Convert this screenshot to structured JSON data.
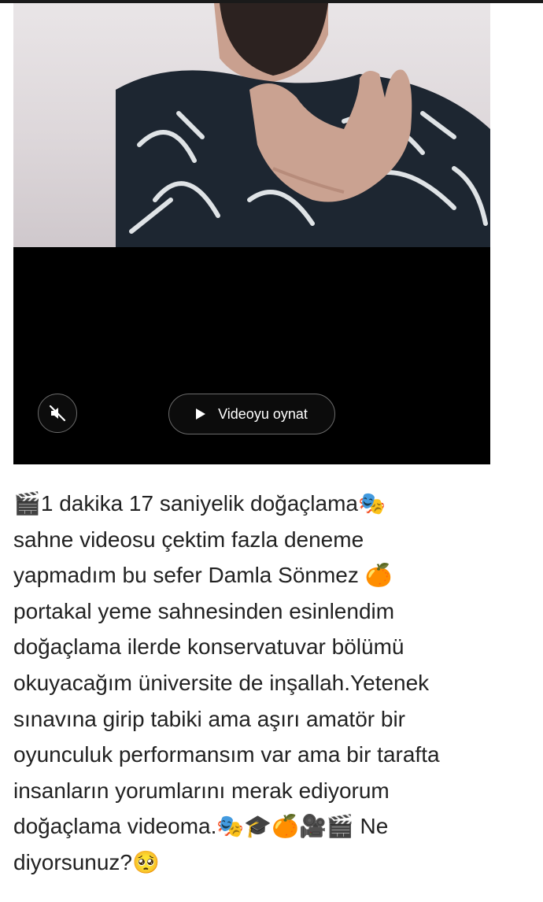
{
  "video": {
    "play_label": "Videoyu oynat",
    "mute_icon": "muted-speaker-icon",
    "play_icon": "play-icon",
    "accent": "#000000"
  },
  "post": {
    "caption": "🎬1 dakika 17 saniyelik doğaçlama🎭\nsahne videosu çektim fazla deneme\nyapmadım bu sefer Damla Sönmez 🍊\nportakal yeme sahnesinden esinlendim\ndoğaçlama ilerde konservatuvar bölümü\nokuyacağım üniversite de inşallah.Yetenek\nsınavına girip tabiki ama aşırı amatör bir\noyunculuk performansım var ama bir tarafta\ninsanların yorumlarını merak ediyorum\ndoğaçlama videoma.🎭🎓🍊🎥🎬 Ne\ndiyorsunuz?🥺"
  }
}
